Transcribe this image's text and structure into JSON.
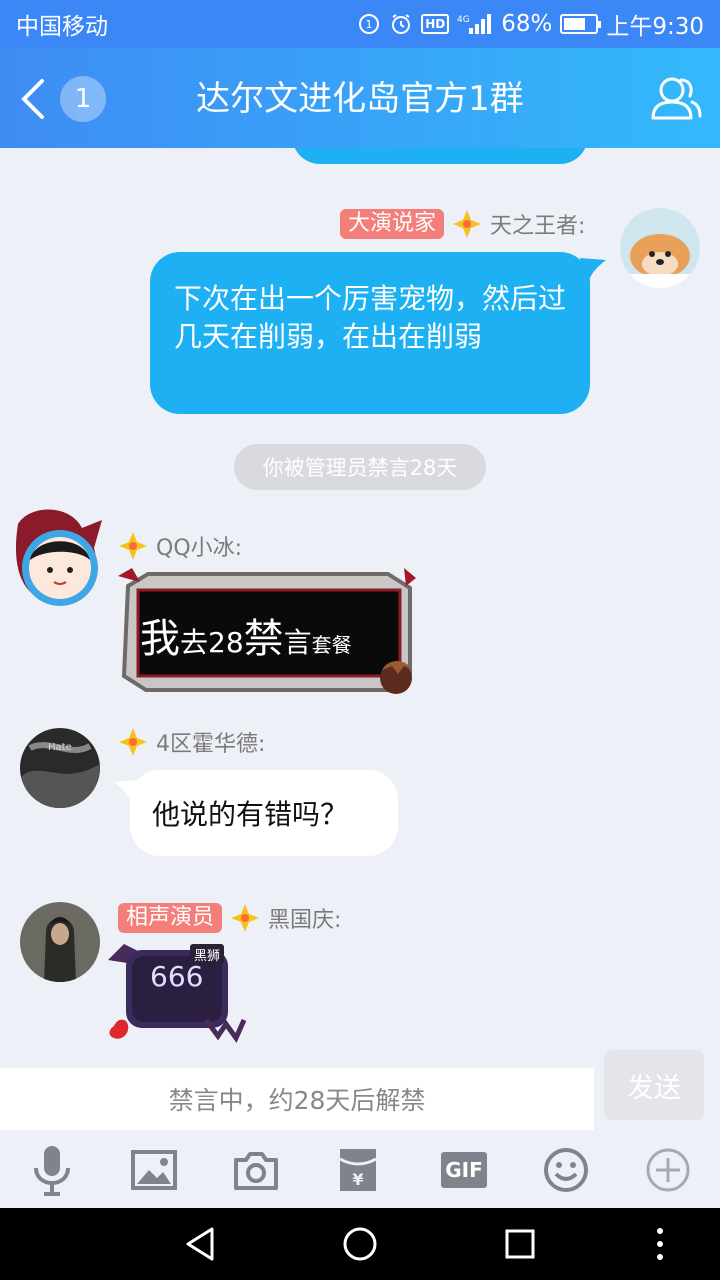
{
  "status_bar": {
    "carrier": "中国移动",
    "hd": "HD",
    "network": "4G",
    "battery": "68%",
    "battery_level": 0.68,
    "time": "上午9:30"
  },
  "header": {
    "back_count": "1",
    "title": "达尔文进化岛官方1群"
  },
  "messages": [
    {
      "tag": "大演说家",
      "name": "天之王者:",
      "text": "下次在出一个厉害宠物，然后过几天在削弱，在出在削弱"
    },
    {
      "name": "QQ小冰:",
      "sticker": {
        "w1": "我",
        "w2": "去28",
        "w3": "禁",
        "w4": "言",
        "w5": "套餐"
      }
    },
    {
      "name": "4区霍华德:",
      "text": "他说的有错吗？",
      "avatar_text": "Hate"
    },
    {
      "tag": "相声演员",
      "name": "黑国庆:",
      "pet_value": "666",
      "pet_badge": "黑狮"
    }
  ],
  "system_notice": "你被管理员禁言28天",
  "input": {
    "placeholder": "禁言中，约28天后解禁",
    "send_label": "发送"
  },
  "toolbar": [
    "mic-icon",
    "image-icon",
    "camera-icon",
    "red-packet-icon",
    "gif-icon",
    "emoji-icon",
    "plus-icon"
  ],
  "gif_label": "GIF",
  "colors": {
    "accent": "#3a87f5",
    "bubble_blue": "#1db0f2",
    "tag_red": "#f47f7a"
  }
}
